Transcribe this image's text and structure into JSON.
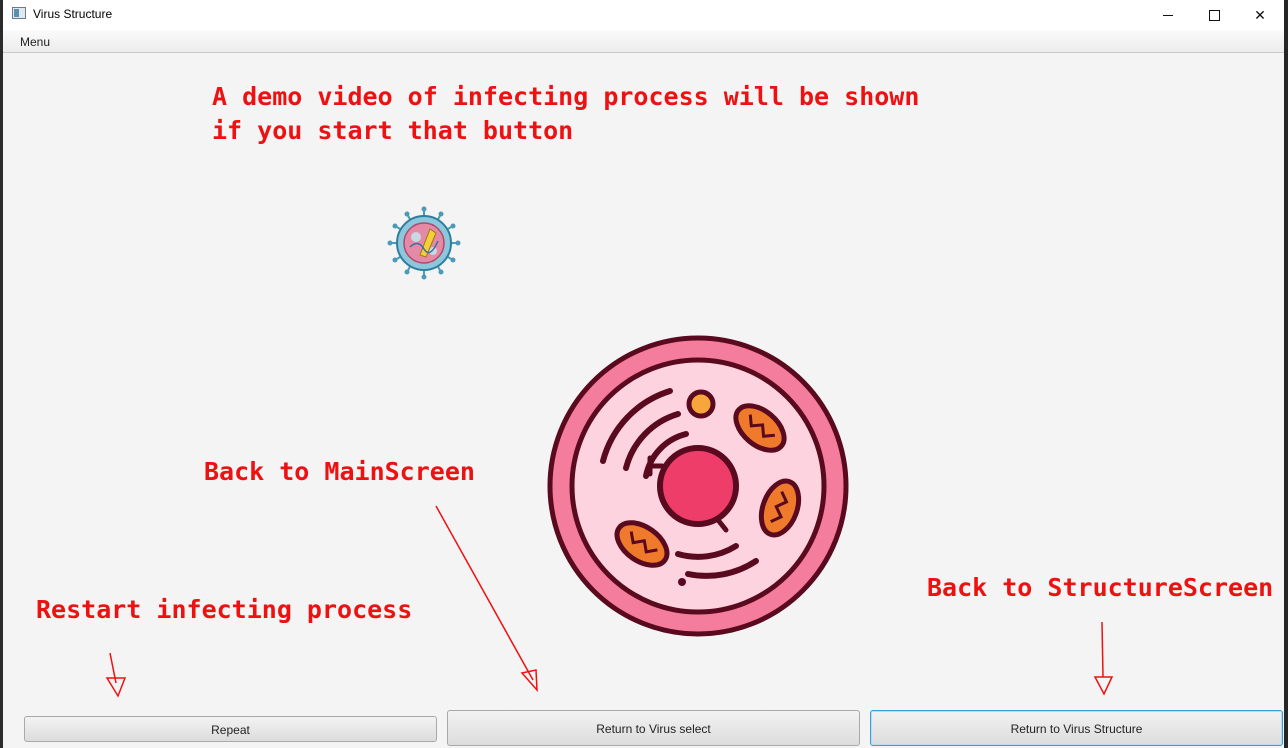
{
  "window": {
    "title": "Virus Structure",
    "controls": {
      "minimize": "minimize",
      "maximize": "maximize",
      "close": "✕"
    }
  },
  "menubar": {
    "menu_label": "Menu"
  },
  "annotations": {
    "demo_line_1": "A demo video of infecting process will be shown",
    "demo_line_2": "if you start that button",
    "back_main": "Back to MainScreen",
    "restart": "Restart infecting process",
    "back_structure": "Back to StructureScreen"
  },
  "buttons": {
    "repeat": "Repeat",
    "virus_select": "Return to Virus select",
    "virus_structure": "Return to Virus Structure"
  },
  "icons": {
    "virus": "virus-icon",
    "cell": "cell-icon"
  },
  "colors": {
    "annotation": "#ee1111",
    "cell_outline": "#5a0a1e",
    "cell_pink": "#f47c9c",
    "cell_fill": "#fcd3de",
    "nucleus": "#ef3d6a",
    "mitochondria": "#f07a2c",
    "focus_border": "#3a9fd6"
  }
}
